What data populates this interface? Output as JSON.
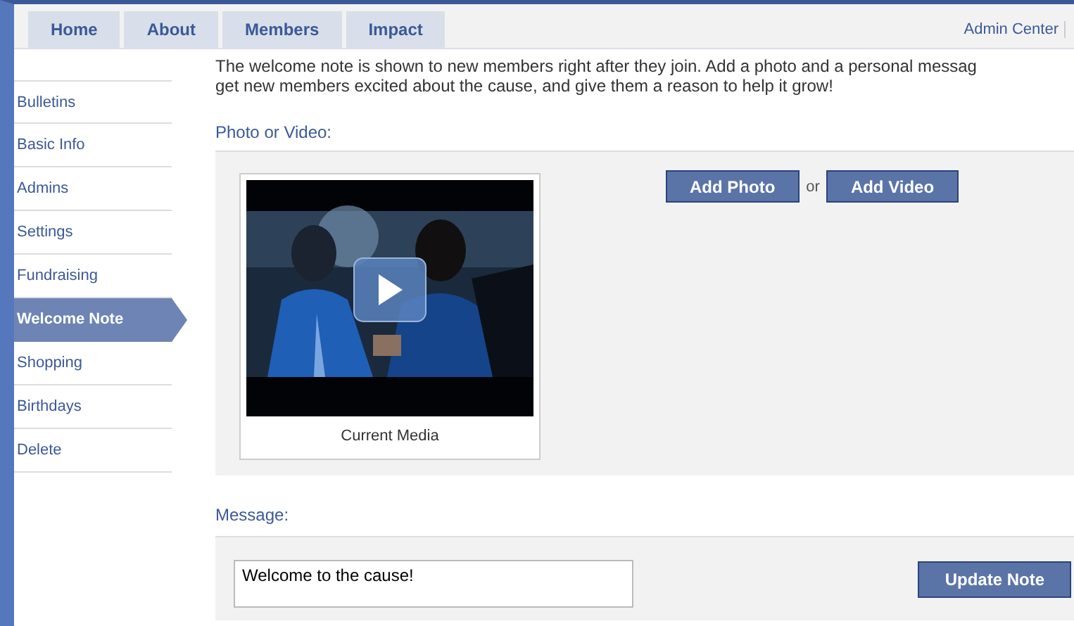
{
  "nav_tabs": [
    "Home",
    "About",
    "Members",
    "Impact"
  ],
  "admin_link": "Admin Center",
  "sidebar": {
    "items": [
      {
        "label": "Bulletins",
        "selected": false
      },
      {
        "label": "Basic Info",
        "selected": false
      },
      {
        "label": "Admins",
        "selected": false
      },
      {
        "label": "Settings",
        "selected": false
      },
      {
        "label": "Fundraising",
        "selected": false
      },
      {
        "label": "Welcome Note",
        "selected": true
      },
      {
        "label": "Shopping",
        "selected": false
      },
      {
        "label": "Birthdays",
        "selected": false
      },
      {
        "label": "Delete",
        "selected": false
      }
    ]
  },
  "intro": [
    "The welcome note is shown to new members right after they join. Add a photo and a personal messag",
    "get new members excited about the cause, and give them a reason to help it grow!"
  ],
  "media": {
    "heading": "Photo or Video:",
    "caption": "Current Media",
    "buttons": [
      "Add Photo",
      "Add Video"
    ],
    "separator": "or"
  },
  "message": {
    "heading": "Message:",
    "value": "Welcome to the cause!",
    "button": "Update Note"
  }
}
